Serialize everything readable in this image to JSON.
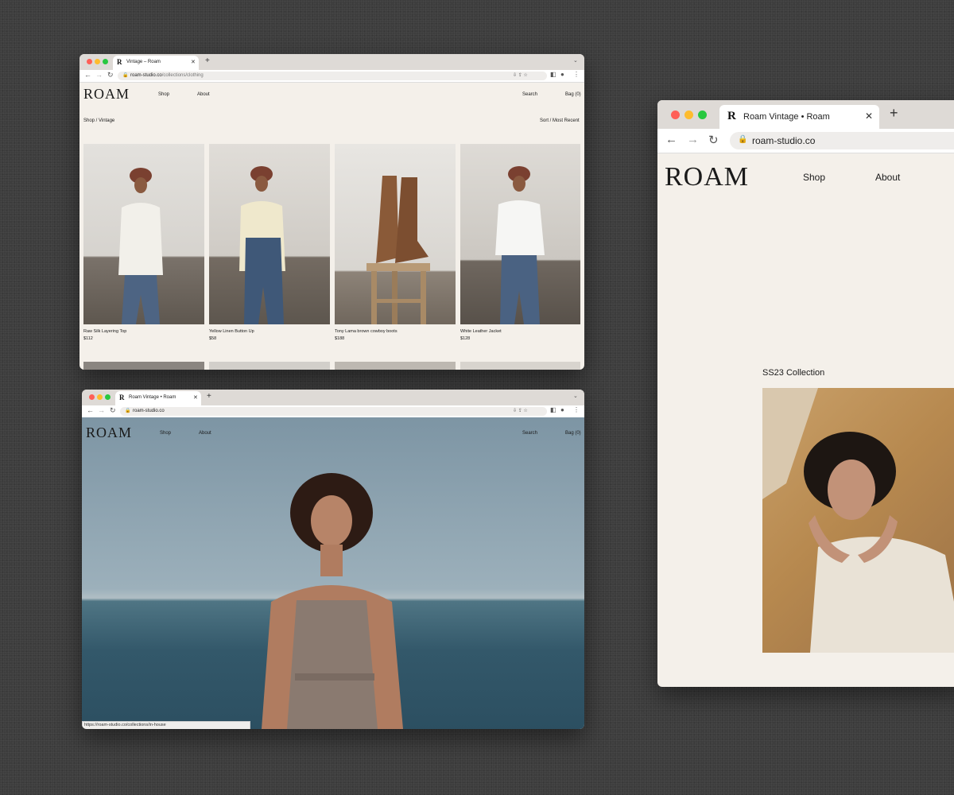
{
  "window1": {
    "tab_title": "Vintage – Roam",
    "url_host": "roam-studio.co",
    "url_path": "/collections/clothing",
    "logo": "ROAM",
    "nav": {
      "shop": "Shop",
      "about": "About",
      "search": "Search",
      "bag": "Bag (0)"
    },
    "breadcrumb": "Shop /  Vintage",
    "sort_label": "Sort /",
    "sort_value": "Most Recent",
    "products": [
      {
        "title": "Raw Silk Layering Top",
        "price": "$112"
      },
      {
        "title": "Yellow Linen Button Up",
        "price": "$58"
      },
      {
        "title": "Tony Lama brown cowboy boots",
        "price": "$188"
      },
      {
        "title": "White Leather Jacket",
        "price": "$128"
      }
    ]
  },
  "window2": {
    "tab_title": "Roam Vintage • Roam",
    "url_host": "roam-studio.co",
    "logo": "ROAM",
    "nav": {
      "shop": "Shop",
      "about": "About",
      "search": "Search",
      "bag": "Bag (0)"
    },
    "hover_status": "https://roam-studio.co/collections/in-house"
  },
  "window3": {
    "tab_title": "Roam Vintage • Roam",
    "url_host": "roam-studio.co",
    "logo": "ROAM",
    "nav": {
      "shop": "Shop",
      "about": "About"
    },
    "collection_label": "SS23 Collection"
  },
  "colors": {
    "close": "#ff5f57",
    "minimize": "#febc2e",
    "maximize": "#28c840",
    "page_bg": "#f4f0ea"
  },
  "icons": [
    "back-arrow-icon",
    "forward-arrow-icon",
    "reload-icon",
    "lock-icon",
    "download-icon",
    "share-icon",
    "bookmark-star-icon",
    "sidebar-icon",
    "profile-icon",
    "more-icon",
    "plus-icon",
    "close-icon",
    "chevron-down-icon"
  ]
}
